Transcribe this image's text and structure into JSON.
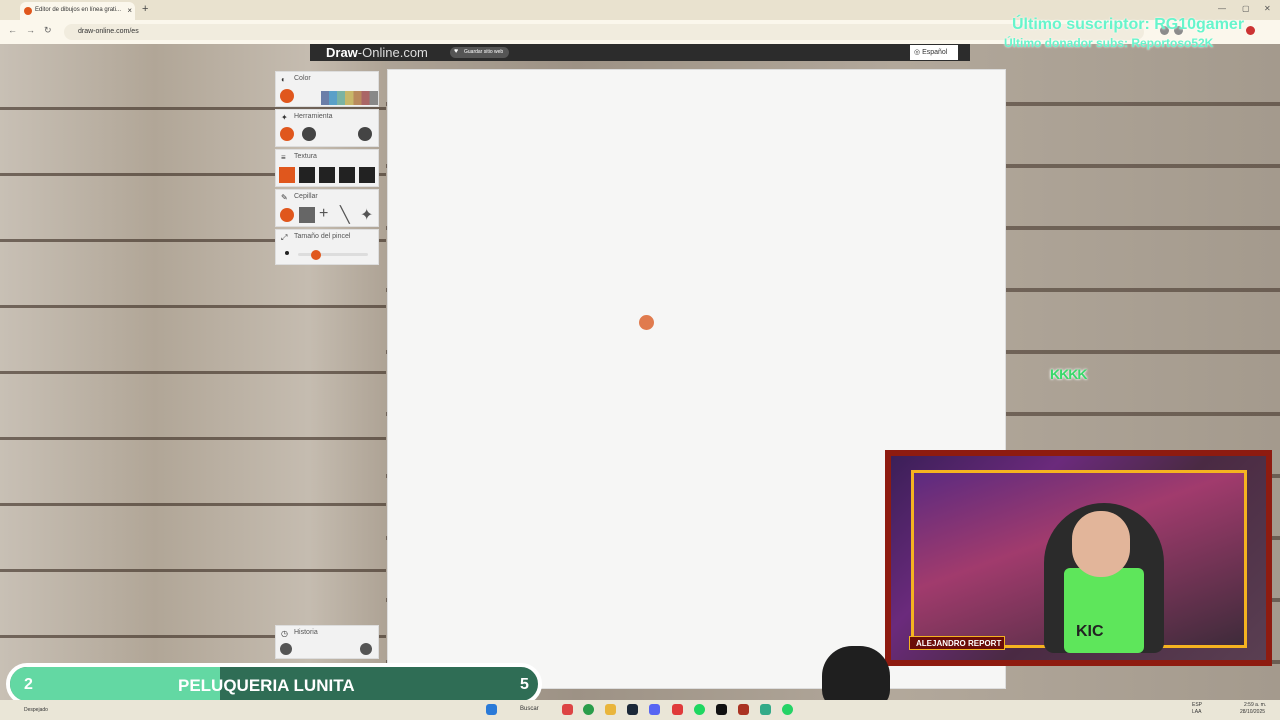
{
  "browser": {
    "tab_title": "Editor de dibujos en línea grati...",
    "tab_close": "×",
    "new_tab": "+",
    "url": "draw-online.com/es",
    "back": "←",
    "forward": "→",
    "reload": "↻",
    "minimize": "—",
    "maximize": "▢",
    "close": "✕"
  },
  "overlay": {
    "last_subscriber": "Último suscriptor: RG10gamer",
    "last_donor": "Último donador subs: Reportoso52K",
    "stream_counter_left": "2",
    "stream_title": "PELUQUERIA LUNITA",
    "stream_counter_right": "5",
    "kkk": "KKKK",
    "cam_badge": "ALEJANDRO REPORT",
    "cam_shirt": "KIC"
  },
  "site": {
    "logo_bold": "Draw",
    "logo_rest": "-Online.com",
    "save_label": "Guardar sitio web",
    "language": "Español"
  },
  "panels": {
    "color": "Color",
    "tool": "Herramienta",
    "texture": "Textura",
    "brush": "Cepillar",
    "brush_size": "Tamaño del pincel",
    "history": "Historia",
    "brush_size_level": 0.25
  },
  "taskbar": {
    "search": "Buscar",
    "lang1": "ESP",
    "lang2": "LAA",
    "time": "2:59 a. m.",
    "date": "28/10/2025",
    "start_hint": "Despejado"
  },
  "colors": {
    "accent": "#e0571d",
    "subscriber_text": "#67f5cc",
    "stream_fill": "#63d8a3"
  }
}
